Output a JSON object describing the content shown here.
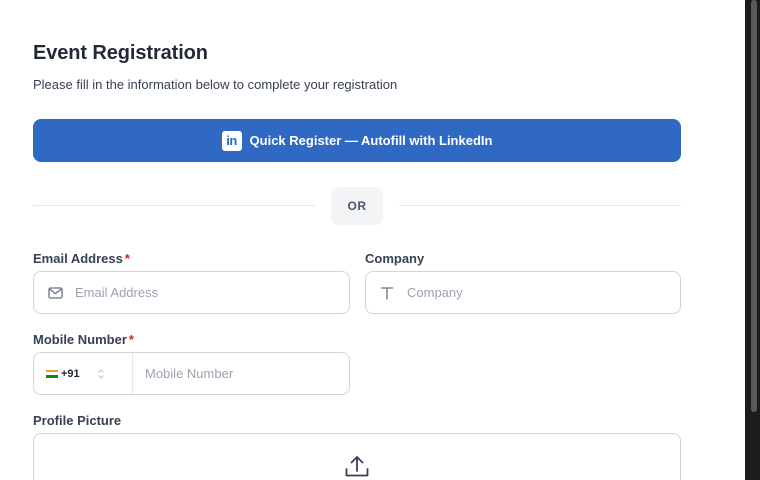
{
  "form": {
    "title": "Event Registration",
    "subtitle": "Please fill in the information below to complete your registration",
    "linkedin_button": "Quick Register — Autofill with LinkedIn",
    "linkedin_logo_text": "in",
    "or_label": "OR",
    "required_mark": "*",
    "email": {
      "label": "Email Address",
      "placeholder": "Email Address",
      "required": true
    },
    "company": {
      "label": "Company",
      "placeholder": "Company",
      "required": false
    },
    "mobile": {
      "label": "Mobile Number",
      "placeholder": "Mobile Number",
      "required": true,
      "country_code": "+91"
    },
    "profile_picture": {
      "label": "Profile Picture"
    }
  },
  "colors": {
    "accent": "#2f69c4",
    "required": "#dc2626",
    "border": "#d1d5db"
  },
  "icons": [
    "linkedin-icon",
    "mail-icon",
    "text-icon",
    "flag-india-icon",
    "chevron-updown-icon",
    "upload-icon"
  ]
}
